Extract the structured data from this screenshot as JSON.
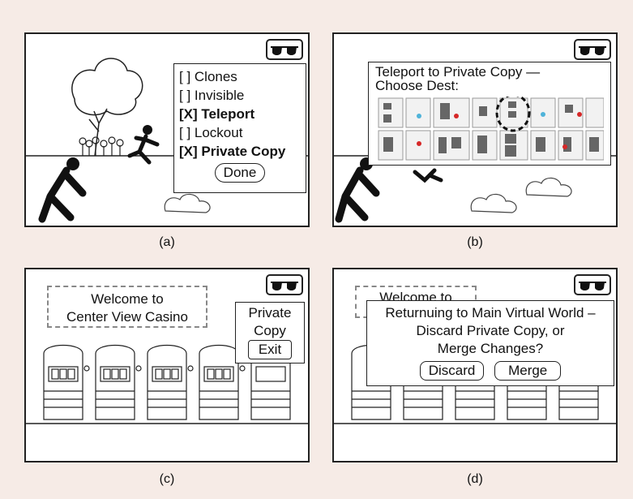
{
  "panels": {
    "a": {
      "caption": "(a)",
      "menu_items": [
        {
          "label": "[ ] Clones",
          "bold": false
        },
        {
          "label": "[ ] Invisible",
          "bold": false
        },
        {
          "label": "[X] Teleport",
          "bold": true
        },
        {
          "label": "[ ] Lockout",
          "bold": false
        },
        {
          "label": "[X] Private Copy",
          "bold": true
        }
      ],
      "done_label": "Done",
      "icon": "sunglasses-icon"
    },
    "b": {
      "caption": "(b)",
      "dialog_line1": "Teleport to Private Copy —",
      "dialog_line2": "Choose Dest:",
      "icon": "sunglasses-icon"
    },
    "c": {
      "caption": "(c)",
      "sign_line1": "Welcome to",
      "sign_line2": "Center View Casino",
      "box_line1": "Private",
      "box_line2": "Copy",
      "exit_label": "Exit",
      "icon": "sunglasses-icon"
    },
    "d": {
      "caption": "(d)",
      "sign_partial": "Welcome to",
      "dialog_line1": "Returnuing to Main Virtual World –",
      "dialog_line2": "Discard Private Copy, or",
      "dialog_line3": "Merge Changes?",
      "discard_label": "Discard",
      "merge_label": "Merge",
      "icon": "sunglasses-icon"
    }
  },
  "colors": {
    "background": "#f6ebe6",
    "map_dot_red": "#d62828",
    "map_dot_cyan": "#4fb3d9",
    "map_block": "#666666"
  }
}
